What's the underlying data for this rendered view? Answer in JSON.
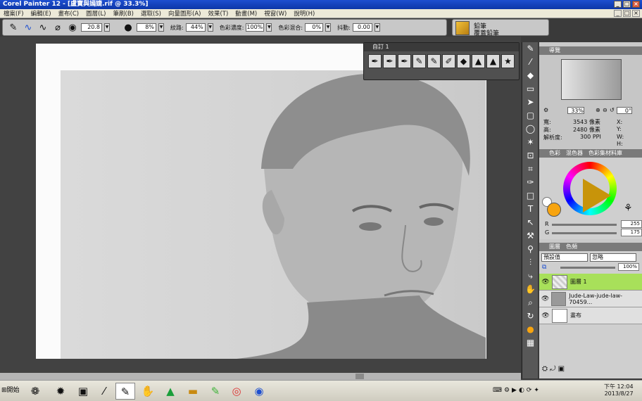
{
  "window": {
    "title": "Corel Painter 12 - [盧寶與嫣婕.rif @ 33.3%]",
    "min": "_",
    "max": "□",
    "close": "×"
  },
  "menu": [
    "檔案(F)",
    "編輯(E)",
    "畫布(C)",
    "圖層(L)",
    "筆刷(B)",
    "選取(S)",
    "向量圖形(A)",
    "效果(T)",
    "動畫(M)",
    "視窗(W)",
    "說明(H)"
  ],
  "props": {
    "size": "20.8",
    "opacity": "8%",
    "grain_label": "紋路:",
    "grain": "44%",
    "resat_label": "色彩濃度:",
    "resat": "100%",
    "bleed_label": "色彩混合:",
    "bleed": "0%",
    "jitter_label": "抖動:",
    "jitter": "0.00"
  },
  "brush": {
    "category": "鉛筆",
    "variant": "覆蓋鉛筆"
  },
  "custom_palette": {
    "title": "自訂 1"
  },
  "navigator": {
    "title": "導覽",
    "zoom": "33%",
    "angle": "0°",
    "width_label": "寬:",
    "width": "3543 像素",
    "height_label": "高:",
    "height": "2480 像素",
    "res_label": "解析度:",
    "res": "300 PPI",
    "x": "X:",
    "y": "Y:",
    "w": "W:",
    "h": "H:"
  },
  "color": {
    "tabs": [
      "色彩",
      "混色器",
      "色彩集材料庫"
    ],
    "r_label": "R",
    "r": "255",
    "g_label": "G",
    "g": "175",
    "main": "#f7a40f"
  },
  "layers": {
    "tabs": [
      "圖層",
      "色頻"
    ],
    "composite": "預設值",
    "method": "忽略",
    "opacity": "100%",
    "items": [
      "圖層 1",
      "Jude-Law-jude-law-70459...",
      "畫布"
    ]
  },
  "taskbar": {
    "start": "開始",
    "time": "下午 12:04",
    "date": "2013/8/27"
  }
}
